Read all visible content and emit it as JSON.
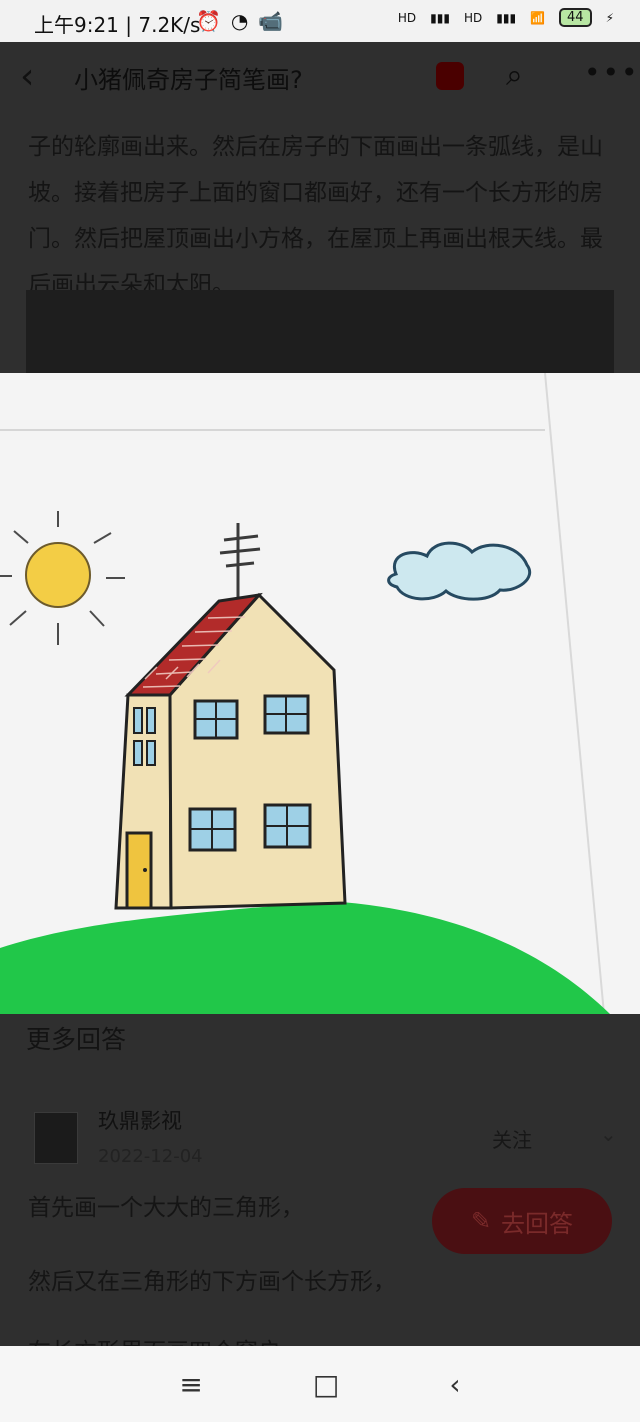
{
  "status": {
    "time": "上午9:21 | 7.2K/s",
    "battery": "44",
    "network_hd1": "HD",
    "network_hd2": "HD"
  },
  "header": {
    "title": "小猪佩奇房子简笔画?"
  },
  "answer": {
    "paragraph": "子的轮廓画出来。然后在房子的下面画出一条弧线，是山坡。接着把房子上面的窗口都画好，还有一个长方形的房门。然后把屋顶画出小方格，在屋顶上再画出根天线。最后画出云朵和太阳。"
  },
  "more_answers": {
    "title": "更多回答",
    "author": "玖鼎影视",
    "date": "2022-12-04",
    "follow": "关注",
    "reply_button": "去回答",
    "line1": "首先画一个大大的三角形，",
    "line2": "然后又在三角形的下方画个长方形，",
    "line3": "在长方形里面画四个窗户"
  },
  "icons": {
    "back": "back-arrow-icon",
    "search": "search-icon",
    "more": "more-dots-icon",
    "menu": "menu-icon",
    "home": "home-icon",
    "nav_back": "nav-back-icon"
  },
  "colors": {
    "accent_red": "#9f1d1d",
    "grass": "#22c84a",
    "sun": "#f1d14a",
    "house": "#f0e0b0"
  }
}
